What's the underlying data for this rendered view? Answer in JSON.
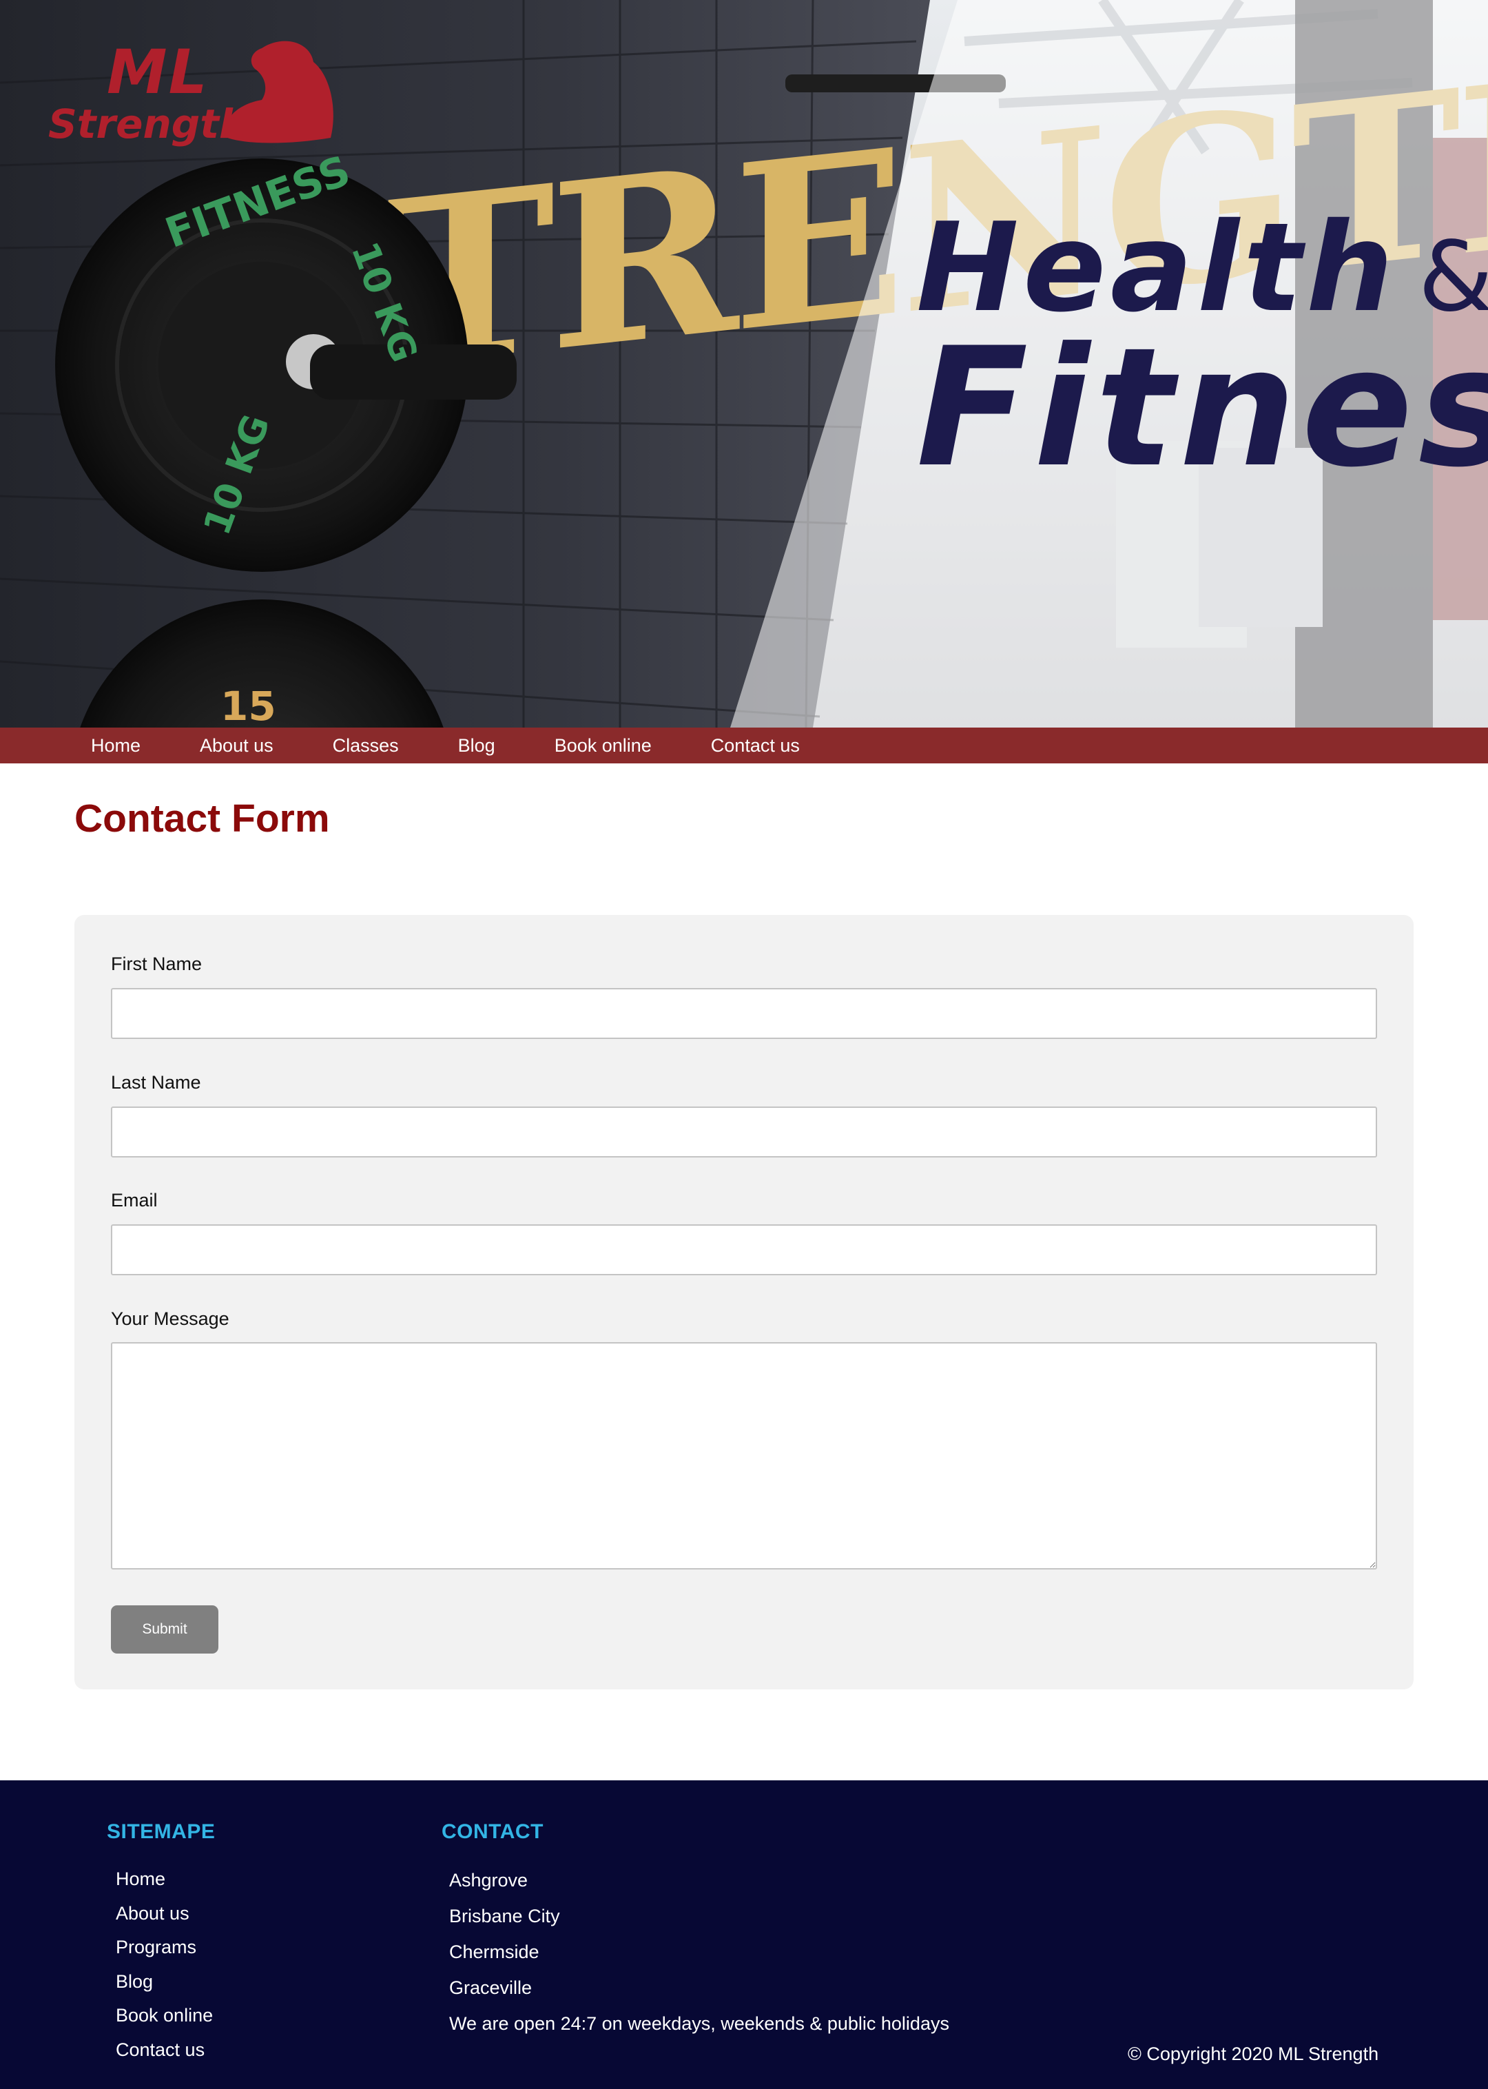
{
  "hero": {
    "logo": {
      "line1": "ML",
      "line2": "Strength",
      "icon": "flexed-arm-icon",
      "color": "#b0202c"
    },
    "wall_text": "STRENGTH",
    "plate_text": "FITNESS",
    "plate_weight_1": "10 KG",
    "plate_weight_2": "15",
    "headline_line1": "Health",
    "headline_amp": "&",
    "headline_line2": "Fitness"
  },
  "nav": {
    "items": [
      {
        "label": "Home"
      },
      {
        "label": "About us"
      },
      {
        "label": "Classes"
      },
      {
        "label": "Blog"
      },
      {
        "label": "Book online"
      },
      {
        "label": "Contact us"
      }
    ]
  },
  "main": {
    "title": "Contact Form",
    "form": {
      "first_name_label": "First Name",
      "first_name_value": "",
      "last_name_label": "Last Name",
      "last_name_value": "",
      "email_label": "Email",
      "email_value": "",
      "message_label": "Your Message",
      "message_value": "",
      "submit_label": "Submit"
    }
  },
  "footer": {
    "sitemap_title": "SITEMAPE",
    "sitemap_items": [
      "Home",
      "About us",
      "Programs",
      "Blog",
      "Book online",
      "Contact us"
    ],
    "contact_title": "CONTACT",
    "contact_items": [
      "Ashgrove",
      "Brisbane City",
      "Chermside",
      "Graceville",
      "We are open 24:7 on weekdays, weekends & public holidays"
    ],
    "copyright": "© Copyright 2020 ML Strength"
  },
  "colors": {
    "nav_bg": "#8a2a2b",
    "title": "#8b0a0a",
    "footer_bg": "#070834",
    "footer_heading": "#33b5e5",
    "headline": "#1c1a4c",
    "submit_bg": "#808080",
    "form_bg": "#f2f2f2"
  }
}
